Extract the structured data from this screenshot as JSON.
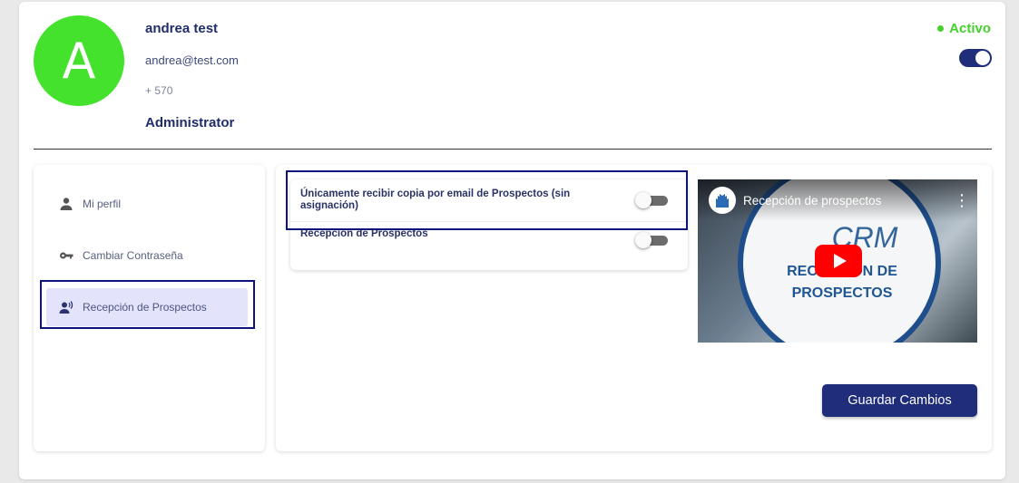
{
  "profile": {
    "avatar_initial": "A",
    "name": "andrea test",
    "email": "andrea@test.com",
    "phone": "+ 570",
    "role": "Administrator",
    "status_label": "Activo",
    "status_active": true
  },
  "sidebar": {
    "items": [
      {
        "label": "Mi perfil",
        "icon": "person-icon",
        "active": false
      },
      {
        "label": "Cambiar Contraseña",
        "icon": "key-icon",
        "active": false
      },
      {
        "label": "Recepción de Prospectos",
        "icon": "voice-person-icon",
        "active": true
      }
    ]
  },
  "settings": {
    "options": [
      {
        "label": "Únicamente recibir copia por email de Prospectos (sin asignación)",
        "enabled": false
      },
      {
        "label": "Recepción de Prospectos",
        "enabled": false
      }
    ]
  },
  "video": {
    "title": "Recepción de prospectos",
    "thumbnail_logo": "CRM",
    "thumbnail_text_line1": "RECEPCIÓN DE",
    "thumbnail_text_line2": "PROSPECTOS"
  },
  "actions": {
    "save_label": "Guardar Cambios"
  },
  "colors": {
    "primary": "#1f2d7a",
    "avatar": "#44e22d",
    "status": "#44d12a",
    "highlight": "#0c137a"
  }
}
